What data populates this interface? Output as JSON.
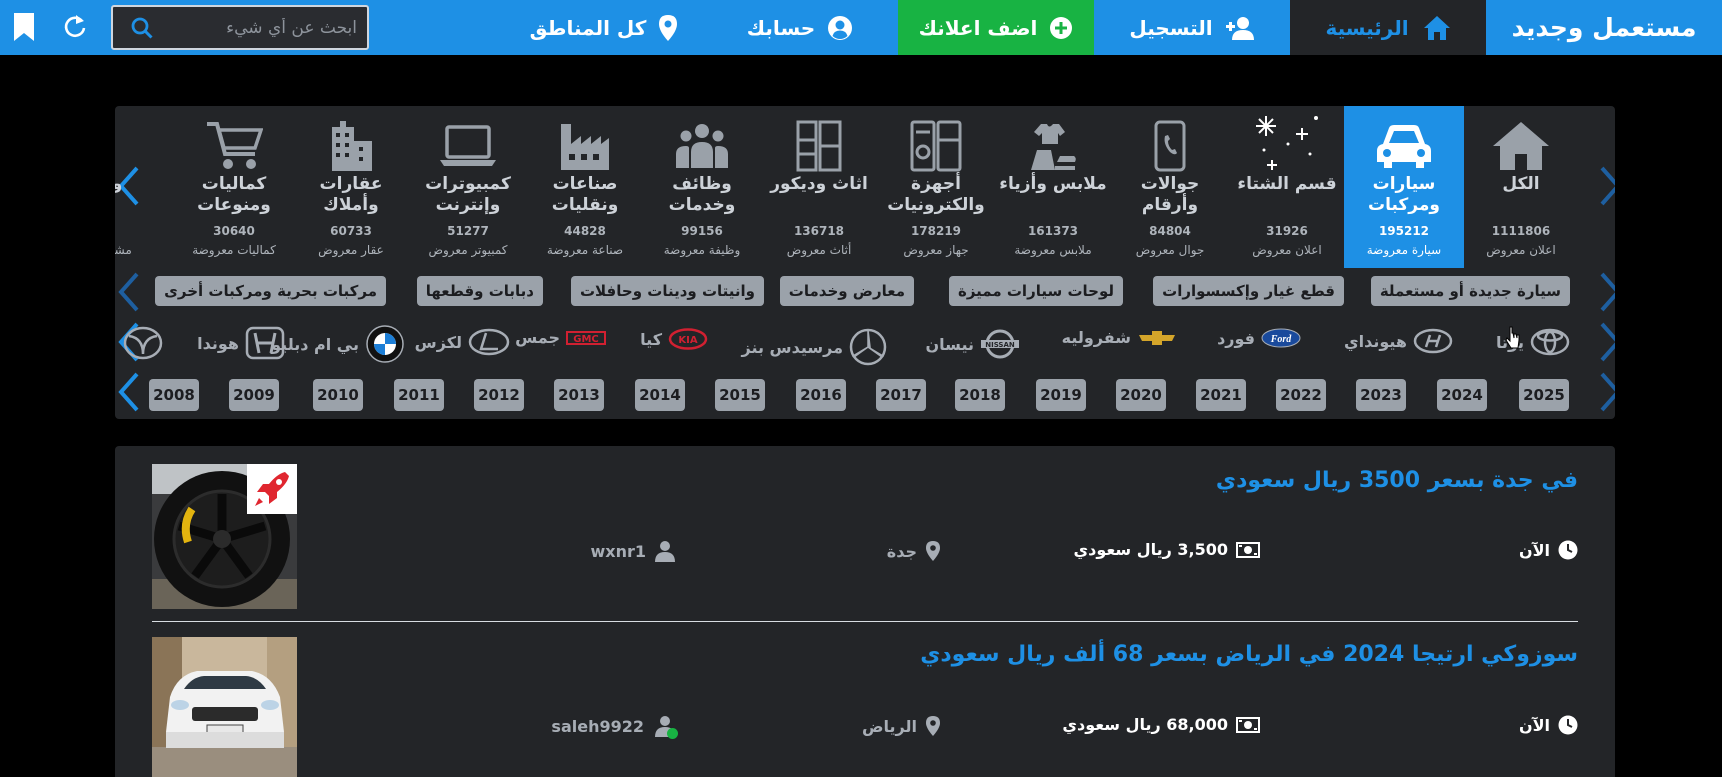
{
  "header": {
    "brand": "مستعمل وجديد",
    "nav_home": "الرئيسية",
    "nav_register": "التسجيل",
    "nav_add_ad": "اضف اعلانك",
    "nav_account": "حسابك",
    "nav_regions": "كل المناطق",
    "search_placeholder": "ابحث عن أي شيء",
    "icons": [
      "home-icon",
      "user-plus-icon",
      "plus-circle-icon",
      "user-circle-icon",
      "map-pin-icon",
      "search-icon",
      "refresh-icon",
      "bookmark-icon"
    ]
  },
  "categories": [
    {
      "name": "الكل",
      "count": "1111806",
      "unit": "اعلان معروض"
    },
    {
      "name": "سيارات ومركبات",
      "count": "195212",
      "unit": "سيارة معروضة",
      "active": true
    },
    {
      "name": "قسم الشتاء",
      "count": "31926",
      "unit": "اعلان معروض"
    },
    {
      "name": "جوالات وأرقام",
      "count": "84804",
      "unit": "جوال معروض"
    },
    {
      "name": "ملابس وأزياء",
      "count": "161373",
      "unit": "ملابس معروضة"
    },
    {
      "name": "أجهزة والكترونيات",
      "count": "178219",
      "unit": "جهاز معروض"
    },
    {
      "name": "اثاث وديكور",
      "count": "136718",
      "unit": "أثاث معروض"
    },
    {
      "name": "وظائف وخدمات",
      "count": "99156",
      "unit": "وظيفة معروضة"
    },
    {
      "name": "صناعات ونقليات",
      "count": "44828",
      "unit": "صناعة معروضة"
    },
    {
      "name": "كمبيوترات وإنترنت",
      "count": "51277",
      "unit": "كمبيوتر معروض"
    },
    {
      "name": "عقارات وأملاك",
      "count": "60733",
      "unit": "عقار معروض"
    },
    {
      "name": "كماليات ومنوعات",
      "count": "30640",
      "unit": "كماليات معروضة"
    },
    {
      "name": "و",
      "count": "",
      "unit": "مشرو"
    }
  ],
  "subcategories": [
    "سيارة جديدة أو مستعملة",
    "قطع غيار وإكسسوارات",
    "لوحات سيارات مميزة",
    "معارض وخدمات",
    "وانيتات ودينات وحافلات",
    "دبابات وقطعها",
    "مركبات بحرية ومركبات أخرى"
  ],
  "brands": [
    "يوتا",
    "هيونداي",
    "فورد",
    "شفروليه",
    "نيسان",
    "مرسيدس بنز",
    "كيا",
    "جمس",
    "لكزس",
    "بي ام دبليو",
    "هوندا"
  ],
  "years": [
    "2025",
    "2024",
    "2023",
    "2022",
    "2021",
    "2020",
    "2019",
    "2018",
    "2017",
    "2016",
    "2015",
    "2014",
    "2013",
    "2012",
    "2011",
    "2010",
    "2009",
    "2008"
  ],
  "listings": [
    {
      "title": "في جدة بسعر 3500 ريال سعودي",
      "time": "الآن",
      "price": "3,500 ريال سعودي",
      "city": "جدة",
      "user": "wxnr1",
      "online": false,
      "featured": true
    },
    {
      "title": "سوزوكي ارتيجا 2024 في الرياض بسعر 68 ألف ريال سعودي",
      "time": "الآن",
      "price": "68,000 ريال سعودي",
      "city": "الرياض",
      "user": "saleh9922",
      "online": true,
      "featured": false
    }
  ],
  "colors": {
    "accent": "#1e90e5",
    "add_button": "#18b343",
    "panel": "#232528",
    "pill": "#9ba2aa",
    "online": "#18b343",
    "featured_badge": "#e0262f"
  }
}
